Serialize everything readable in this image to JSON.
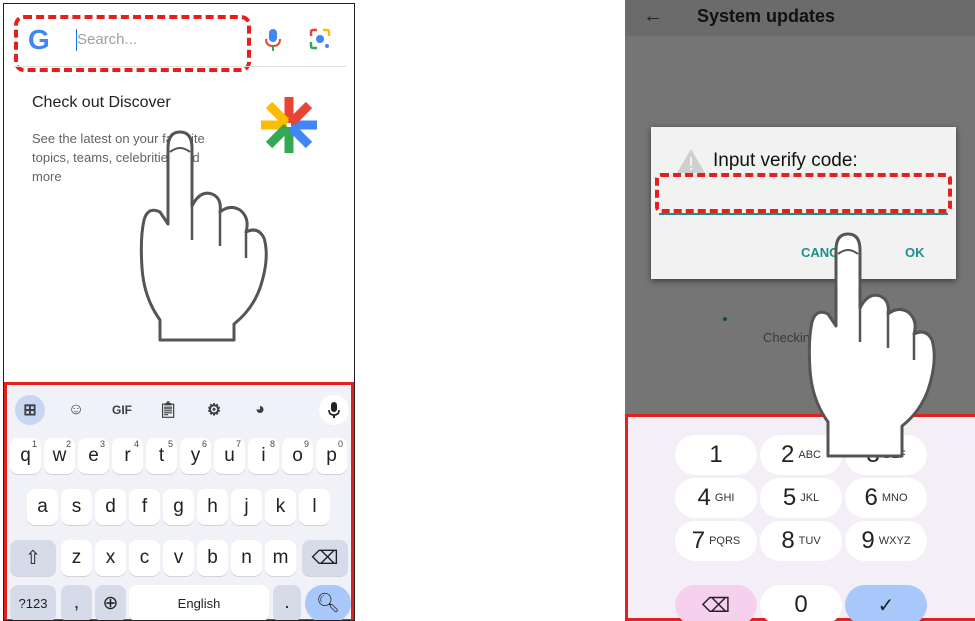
{
  "left_phone": {
    "search": {
      "placeholder": "Search..."
    },
    "discover": {
      "title": "Check out Discover",
      "description": "See the latest on your favorite topics, teams, celebrities and more"
    },
    "keyboard": {
      "toolbar": [
        "apps-icon",
        "sticker-icon",
        "GIF",
        "clipboard-icon",
        "settings-icon",
        "palette-icon",
        "mic-icon"
      ],
      "gif_label": "GIF",
      "row1": [
        "q",
        "w",
        "e",
        "r",
        "t",
        "y",
        "u",
        "i",
        "o",
        "p"
      ],
      "row1_hints": [
        "1",
        "2",
        "3",
        "4",
        "5",
        "6",
        "7",
        "8",
        "9",
        "0"
      ],
      "row2": [
        "a",
        "s",
        "d",
        "f",
        "g",
        "h",
        "j",
        "k",
        "l"
      ],
      "row3": [
        "z",
        "x",
        "c",
        "v",
        "b",
        "n",
        "m"
      ],
      "symbols_key": "?123",
      "space_label": "English",
      "period_key": ".",
      "emoji_comma": ","
    }
  },
  "right_phone": {
    "title": "System updates",
    "dialog": {
      "title": "Input verify code:",
      "cancel": "CANCEL",
      "ok": "OK"
    },
    "status": "Checking",
    "numpad": [
      {
        "digit": "1",
        "letters": ""
      },
      {
        "digit": "2",
        "letters": "ABC"
      },
      {
        "digit": "3",
        "letters": "DEF"
      },
      {
        "digit": "4",
        "letters": "GHI"
      },
      {
        "digit": "5",
        "letters": "JKL"
      },
      {
        "digit": "6",
        "letters": "MNO"
      },
      {
        "digit": "7",
        "letters": "PQRS"
      },
      {
        "digit": "8",
        "letters": "TUV"
      },
      {
        "digit": "9",
        "letters": "WXYZ"
      },
      {
        "digit": "0",
        "letters": ""
      }
    ]
  },
  "colors": {
    "highlight": "#e3201b",
    "accent_teal": "#1c8f8a",
    "key_action": "#a8c7fa",
    "backspace_pink": "#f6d1ee",
    "done_blue": "#a8c7fa"
  }
}
